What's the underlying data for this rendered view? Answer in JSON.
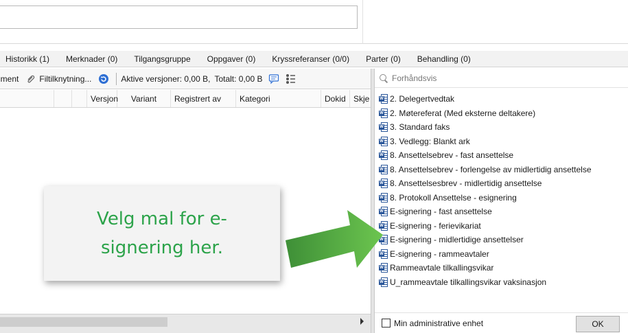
{
  "tabs": [
    "Historikk (1)",
    "Merknader (0)",
    "Tilgangsgruppe",
    "Oppgaver (0)",
    "Kryssreferanser (0/0)",
    "Parter (0)",
    "Behandling (0)"
  ],
  "toolbar": {
    "document_label": "ument",
    "file_link_label": "Filtilknytning...",
    "active_versions": "Aktive versjoner: 0,00 B,",
    "total": "Totalt: 0,00 B"
  },
  "columns": [
    "Versjon",
    "Variant",
    "Registrert av",
    "Kategori",
    "Dokid",
    "Skje"
  ],
  "preview": {
    "search_placeholder": "Forhåndsvis",
    "templates": [
      "2. Delegertvedtak",
      "2. Møtereferat (Med eksterne deltakere)",
      "3. Standard faks",
      "3. Vedlegg: Blankt ark",
      "8. Ansettelsebrev - fast ansettelse",
      "8. Ansettelsebrev - forlengelse av midlertidig ansettelse",
      "8. Ansettelsesbrev - midlertidig ansettelse",
      "8. Protokoll Ansettelse - esignering",
      "E-signering - fast ansettelse",
      "E-signering - ferievikariat",
      "E-signering - midlertidige ansettelser",
      "E-signering - rammeavtaler",
      "Rammeavtale tilkallingsvikar",
      "U_rammeavtale tilkallingsvikar vaksinasjon"
    ],
    "checkbox_label": "Min administrative enhet",
    "ok_label": "OK"
  },
  "callout": {
    "line1": "Velg mal for e-",
    "line2": "signering her."
  },
  "colors": {
    "callout_text": "#2ca34a",
    "arrow_green": "#5dba47",
    "word_blue": "#2b579a"
  },
  "icons": {
    "file_link": "paperclip-icon",
    "refresh": "refresh-icon",
    "comment": "comment-icon",
    "columns": "column-chooser-icon",
    "search": "search-icon",
    "template": "word-document-icon"
  }
}
